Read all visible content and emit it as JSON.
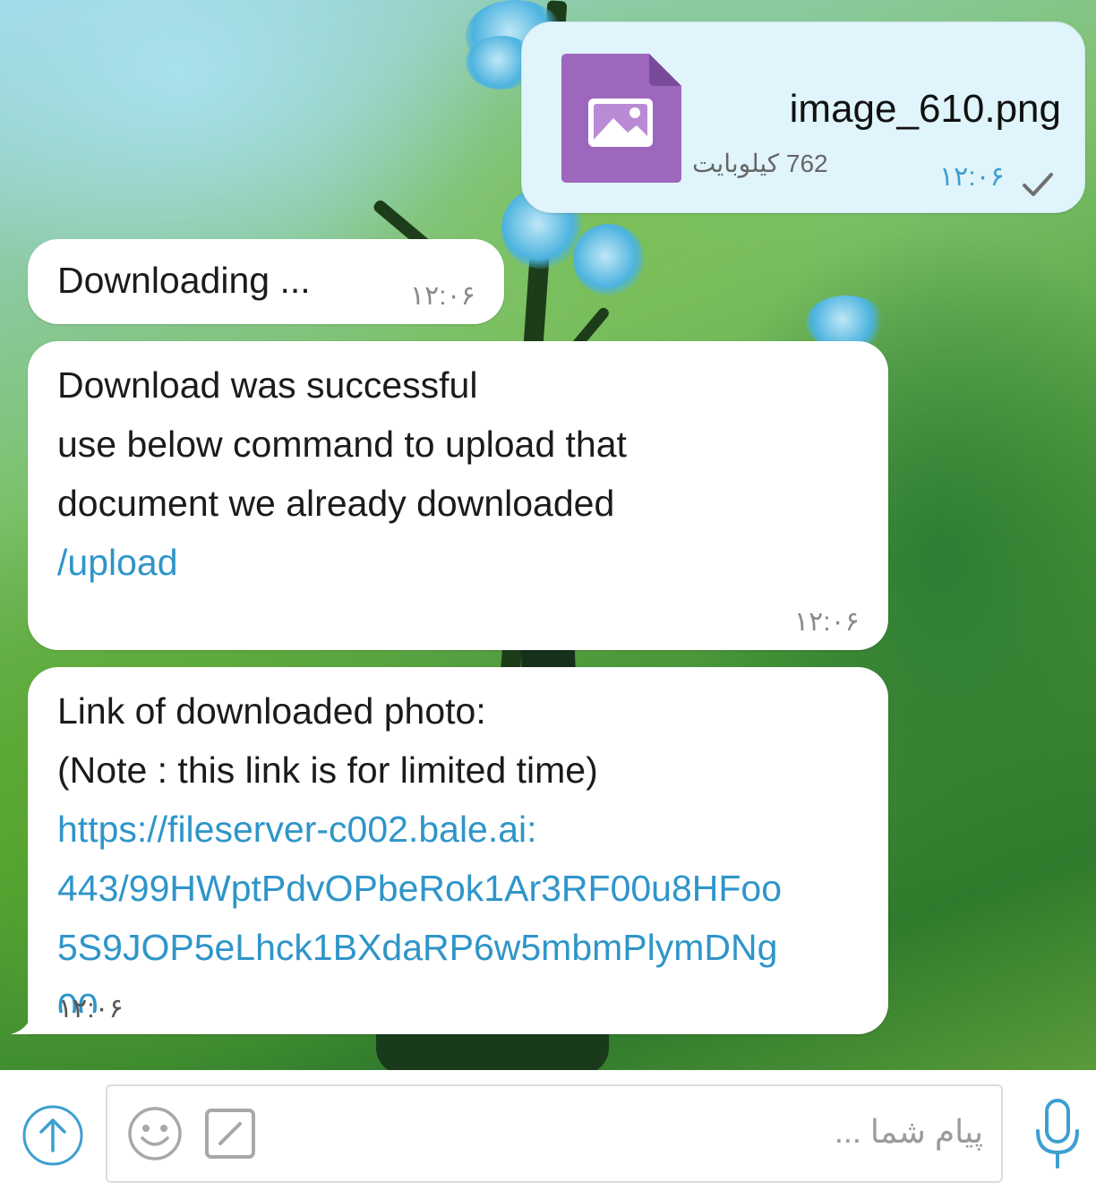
{
  "chat": {
    "file_message": {
      "file_name": "image_610.png",
      "file_size": "762 کیلوبایت",
      "time": "۱۲:۰۶",
      "status_icon": "check-icon",
      "file_icon": "image-file-icon",
      "accent_color": "#9c67bd"
    },
    "messages": [
      {
        "lines": [
          "Downloading ..."
        ],
        "time": "۱۲:۰۶"
      },
      {
        "lines": [
          "Download was successful",
          "use below command to upload that",
          "document we already downloaded"
        ],
        "command": "/upload",
        "time": "۱۲:۰۶"
      },
      {
        "lines": [
          "Link of downloaded photo:",
          "(Note : this link is for limited time)"
        ],
        "link_lines": [
          "https://fileserver-c002.bale.ai:",
          "443/99HWptPdvOPbeRok1Ar3RF00u8HFoo",
          "5S9JOP5eLhck1BXdaRP6w5mbmPlymDNg",
          "00"
        ],
        "time": "۱۲:۰۶"
      }
    ]
  },
  "composer": {
    "placeholder": "پیام شما ...",
    "attach_icon": "upload-arrow-icon",
    "emoji_icon": "emoji-icon",
    "command_icon": "slash-command-icon",
    "mic_icon": "microphone-icon",
    "link_color": "#2f95c9"
  }
}
